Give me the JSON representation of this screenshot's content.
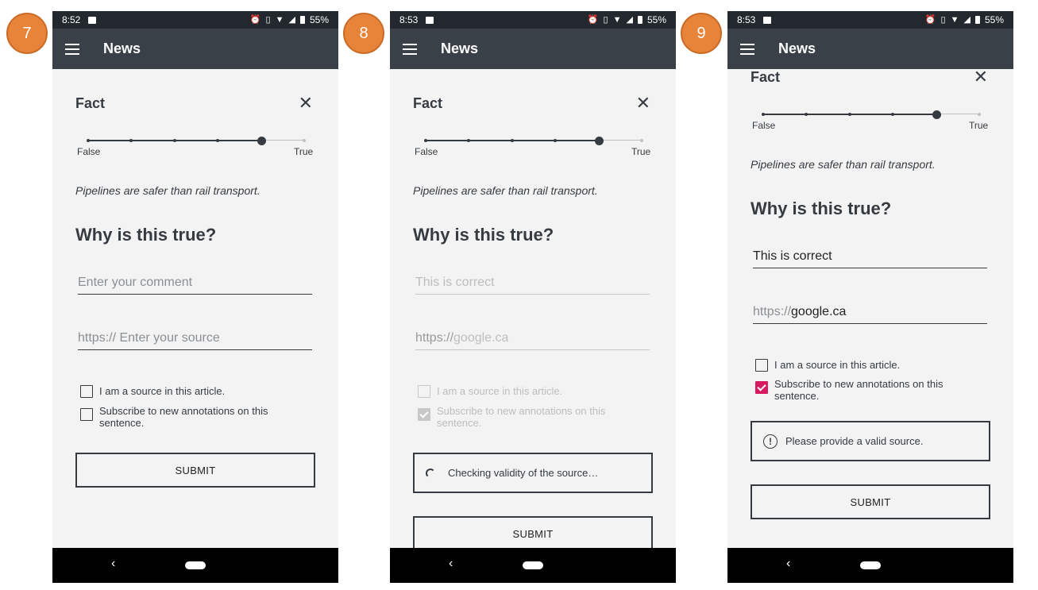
{
  "status": {
    "battery_text": "55%"
  },
  "app": {
    "title": "News"
  },
  "slider": {
    "min_label": "False",
    "max_label": "True",
    "value_fraction": 0.8,
    "steps": 5
  },
  "screens": [
    {
      "step": "7",
      "time": "8:52",
      "fact_label": "Fact",
      "statement": "Pipelines are safer than rail transport.",
      "question": "Why is this true?",
      "comment_placeholder": "Enter your comment",
      "source_prefix": "https://",
      "source_value": " Enter your source",
      "checkbox_source_label": "I am a source in this article.",
      "checkbox_subscribe_label": "Subscribe to new annotations on this sentence.",
      "submit_label": "SUBMIT"
    },
    {
      "step": "8",
      "time": "8:53",
      "fact_label": "Fact",
      "statement": "Pipelines are safer than rail transport.",
      "question": "Why is this true?",
      "comment_value": "This is correct",
      "source_prefix": "https://",
      "source_value": "google.ca",
      "checkbox_source_label": "I am a source in this article.",
      "checkbox_subscribe_label": "Subscribe to new annotations on this sentence.",
      "checking_text": "Checking validity of the source…",
      "submit_label": "SUBMIT"
    },
    {
      "step": "9",
      "time": "8:53",
      "fact_label": "Fact",
      "statement": "Pipelines are safer than rail transport.",
      "question": "Why is this true?",
      "comment_value": "This is correct",
      "source_prefix": "https://",
      "source_value": "google.ca",
      "checkbox_source_label": "I am a source in this article.",
      "checkbox_subscribe_label": "Subscribe to new annotations on this sentence.",
      "error_text": "Please provide a valid source.",
      "submit_label": "SUBMIT"
    }
  ],
  "colors": {
    "step_badge": "#e8833a",
    "appbar": "#394048",
    "statusbar": "#23282e",
    "checkbox_checked": "#d81b60",
    "text_dark": "#353b41"
  }
}
